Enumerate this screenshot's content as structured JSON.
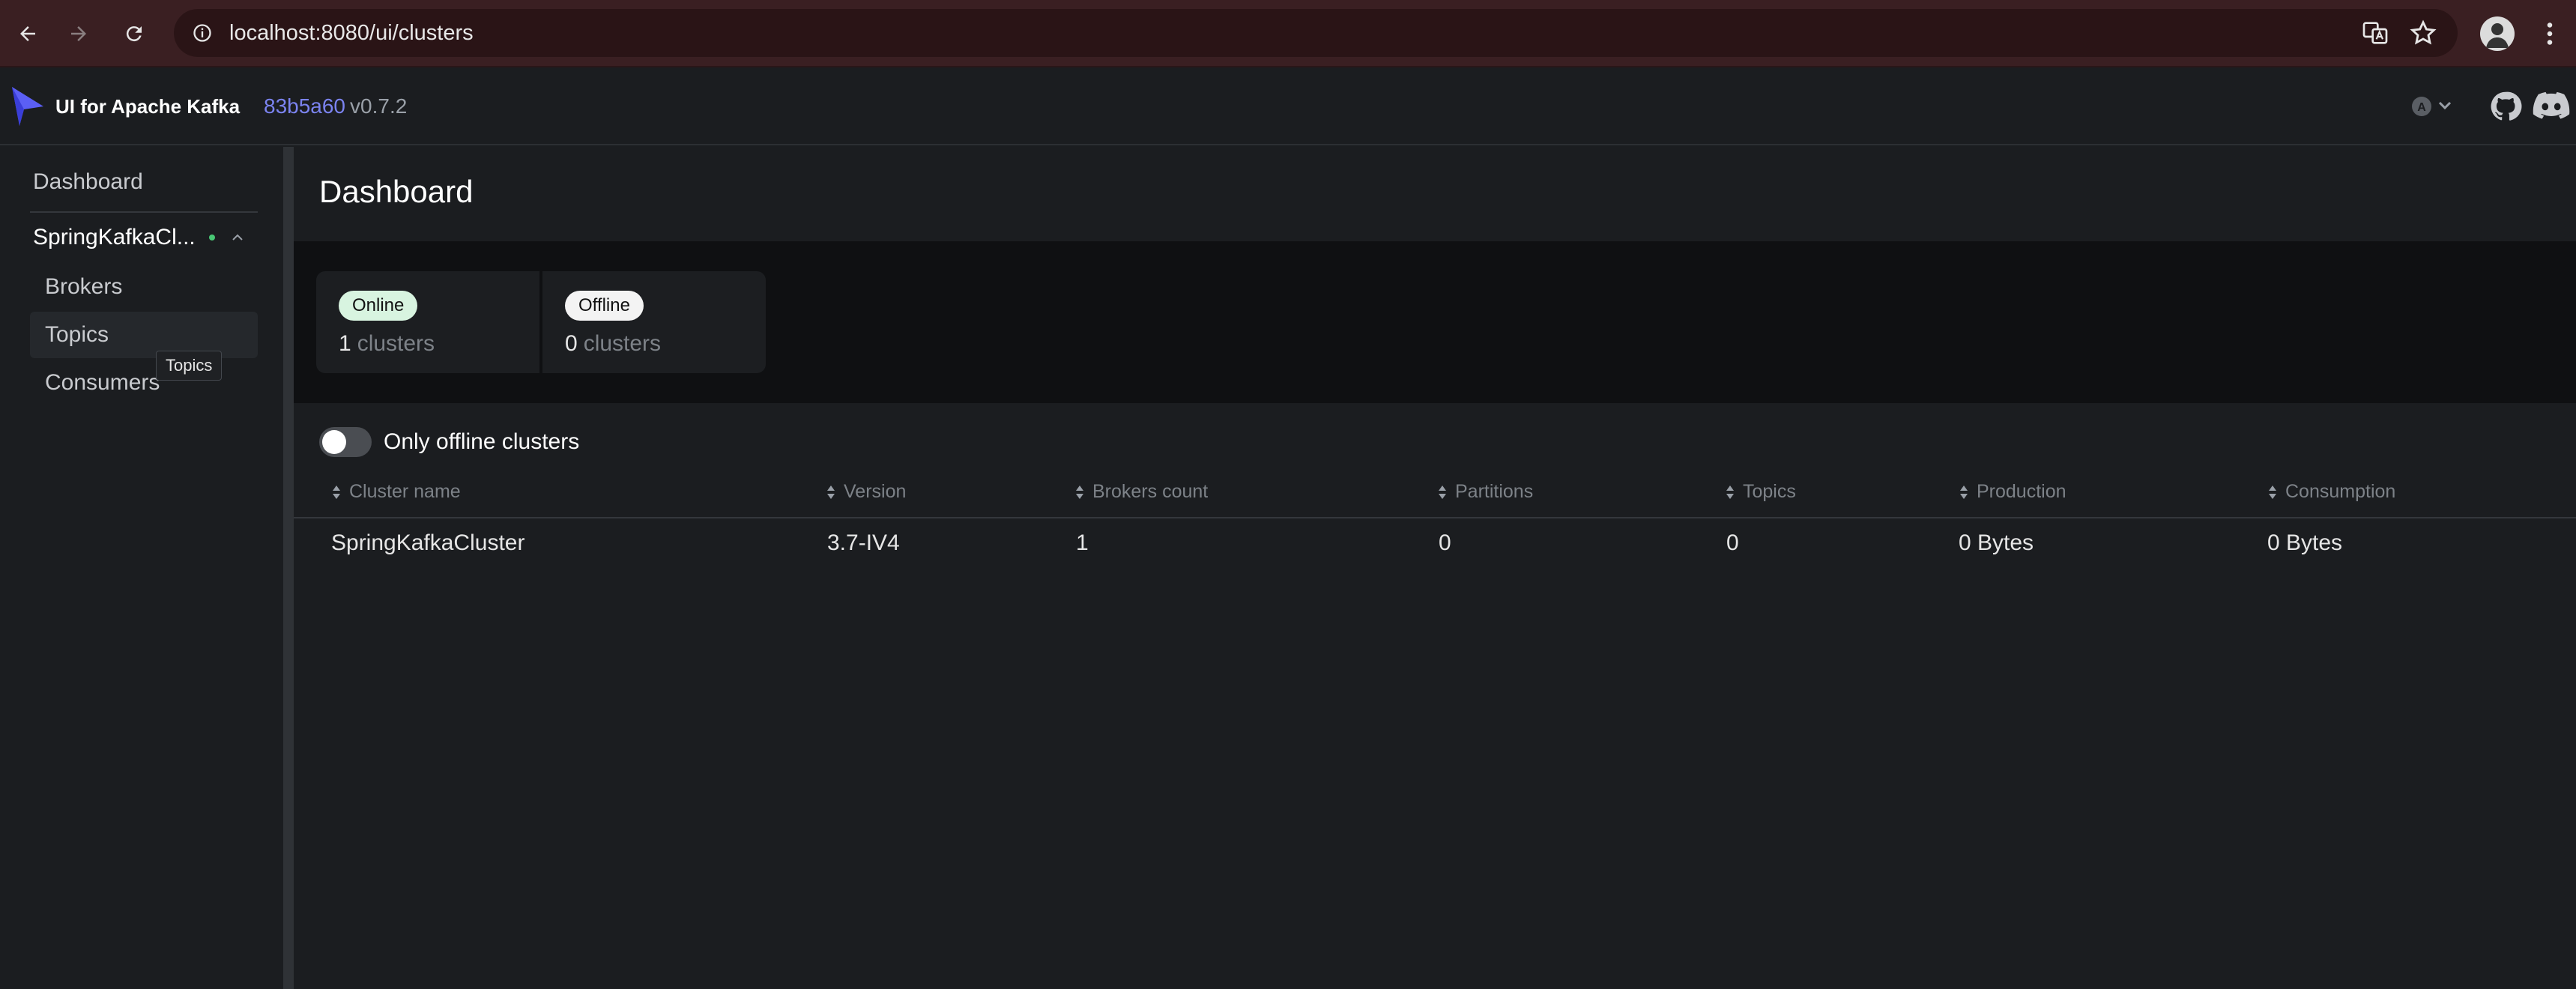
{
  "browser": {
    "url": "localhost:8080/ui/clusters"
  },
  "header": {
    "brand": "UI for Apache Kafka",
    "version_hash": "83b5a60",
    "version": "v0.7.2",
    "theme_letter": "A"
  },
  "sidebar": {
    "dashboard": "Dashboard",
    "cluster_name": "SpringKafkaCl...",
    "items": [
      "Brokers",
      "Topics",
      "Consumers"
    ],
    "tooltip": "Topics"
  },
  "main": {
    "title": "Dashboard",
    "online": {
      "badge": "Online",
      "count": "1",
      "unit": "clusters"
    },
    "offline": {
      "badge": "Offline",
      "count": "0",
      "unit": "clusters"
    },
    "toggle_label": "Only offline clusters",
    "columns": [
      "Cluster name",
      "Version",
      "Brokers count",
      "Partitions",
      "Topics",
      "Production",
      "Consumption"
    ],
    "rows": [
      [
        "SpringKafkaCluster",
        "3.7-IV4",
        "1",
        "0",
        "0",
        "0 Bytes",
        "0 Bytes"
      ]
    ]
  },
  "colors": {
    "accent": "#7b83f0",
    "online_badge": "#d8f4e0",
    "status_dot": "#48c774"
  }
}
